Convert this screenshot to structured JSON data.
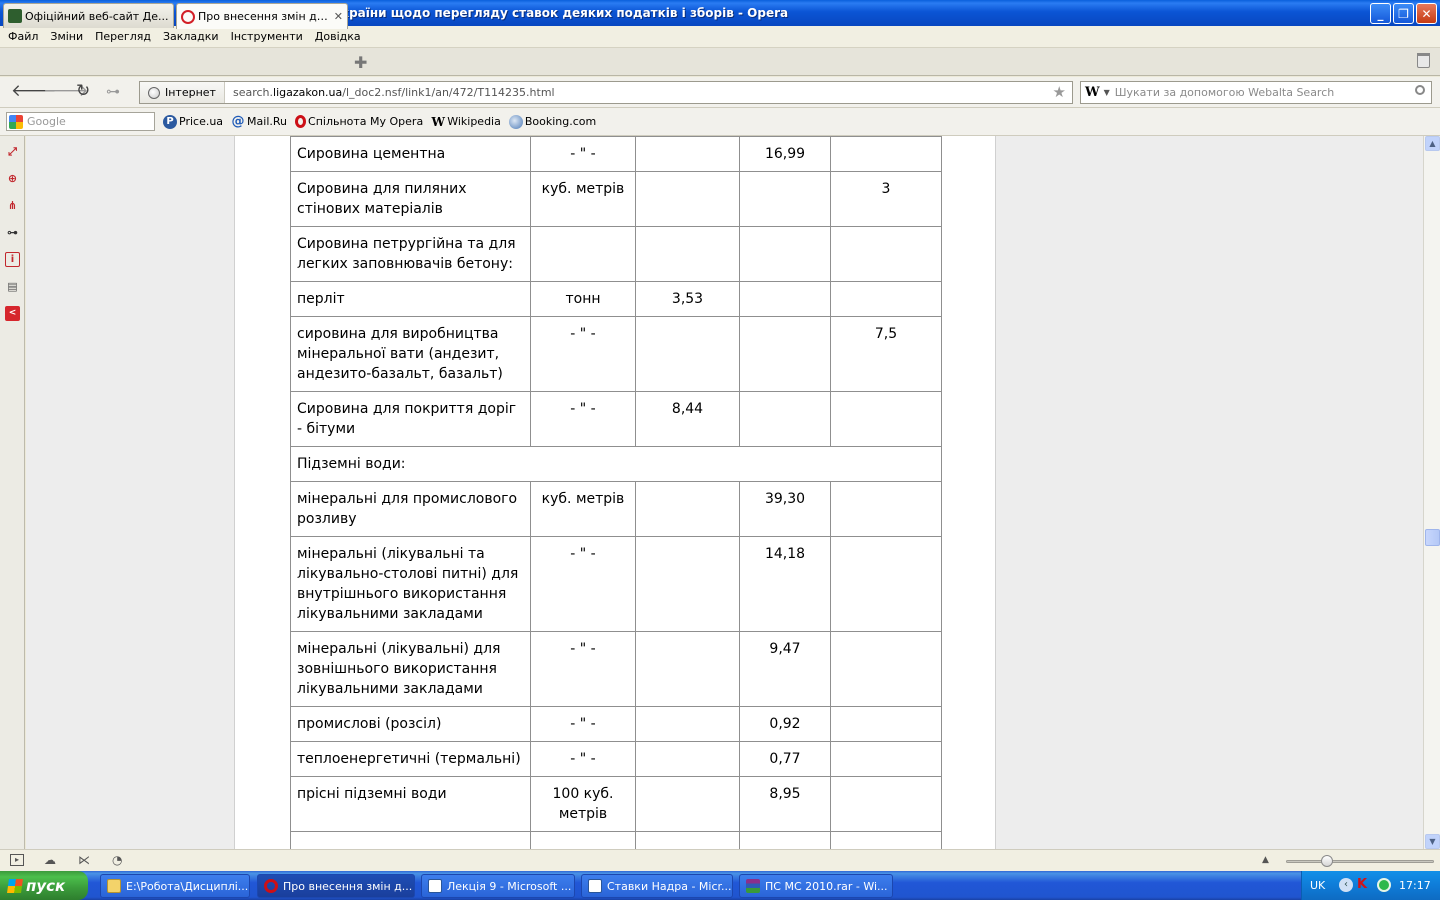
{
  "window": {
    "title": "Про внесення змін до Податкового кодексу України щодо перегляду ставок деяких податків і зборів - Opera",
    "minimize_label": "_",
    "maximize_label": "❐",
    "close_label": "✕"
  },
  "menu": [
    "Файл",
    "Зміни",
    "Перегляд",
    "Закладки",
    "Інструменти",
    "Довідка"
  ],
  "tabs": [
    {
      "label": "Офіційний веб-сайт Де...",
      "icon": "trident-icon"
    },
    {
      "label": "Про внесення змін до П...",
      "icon": "liga-icon",
      "close": "✕"
    }
  ],
  "address": {
    "site_label": "Інтернет",
    "url_prefix": "search.",
    "url_domain": "ligazakon.ua",
    "url_path": "/l_doc2.nsf/link1/an/472/T114235.html"
  },
  "search": {
    "engine": "W",
    "placeholder": "Шукати за допомогою Webalta Search"
  },
  "bookmarks": {
    "google_placeholder": "Google",
    "items": [
      {
        "label": "Price.ua",
        "icon": "price-icon"
      },
      {
        "label": "Mail.Ru",
        "icon": "mailru-icon"
      },
      {
        "label": "Спільнота My Opera",
        "icon": "opera-icon"
      },
      {
        "label": "Wikipedia",
        "icon": "wikipedia-icon"
      },
      {
        "label": "Booking.com",
        "icon": "booking-icon"
      }
    ]
  },
  "table": {
    "rows": [
      {
        "name": "",
        "unit": "",
        "c3": "",
        "c4": "",
        "c5": ""
      },
      {
        "name": "Сировина цементна",
        "unit": "- \" -",
        "c3": "",
        "c4": "16,99",
        "c5": ""
      },
      {
        "name": "Сировина для пиляних стінових матеріалів",
        "unit": "куб. метрів",
        "c3": "",
        "c4": "",
        "c5": "3"
      },
      {
        "name": "Сировина петрургійна та для легких заповнювачів бетону:",
        "unit": "",
        "c3": "",
        "c4": "",
        "c5": ""
      },
      {
        "name": "перліт",
        "unit": "тонн",
        "c3": "3,53",
        "c4": "",
        "c5": ""
      },
      {
        "name": "сировина для виробництва мінеральної вати (андезит, андезито-базальт, базальт)",
        "unit": "- \" -",
        "c3": "",
        "c4": "",
        "c5": "7,5"
      },
      {
        "name": "Сировина для покриття доріг - бітуми",
        "unit": "- \" -",
        "c3": "8,44",
        "c4": "",
        "c5": ""
      },
      {
        "section": "Підземні води:"
      },
      {
        "name": "мінеральні для промислового розливу",
        "unit": "куб. метрів",
        "c3": "",
        "c4": "39,30",
        "c5": ""
      },
      {
        "name": "мінеральні (лікувальні та лікувально-столові питні) для внутрішнього використання лікувальними закладами",
        "unit": "- \" -",
        "c3": "",
        "c4": "14,18",
        "c5": ""
      },
      {
        "name": "мінеральні (лікувальні) для зовнішнього використання лікувальними закладами",
        "unit": "- \" -",
        "c3": "",
        "c4": "9,47",
        "c5": ""
      },
      {
        "name": "промислові (розсіл)",
        "unit": "- \" -",
        "c3": "",
        "c4": "0,92",
        "c5": ""
      },
      {
        "name": "теплоенергетичні (термальні)",
        "unit": "- \" -",
        "c3": "",
        "c4": "0,77",
        "c5": ""
      },
      {
        "name": "прісні підземні води",
        "unit": "100 куб. метрів",
        "c3": "",
        "c4": "8,95",
        "c5": ""
      },
      {
        "name": "",
        "unit": "",
        "c3": "",
        "c4": "",
        "c5": ""
      }
    ]
  },
  "taskbar": {
    "start_label": "пуск",
    "tasks": [
      {
        "label": "E:\\Робота\\Дисциплі...",
        "icon": "folder-icon"
      },
      {
        "label": "Про внесення змін д...",
        "icon": "opera-icon"
      },
      {
        "label": "Лекція 9 - Microsoft ...",
        "icon": "word-icon"
      },
      {
        "label": "Ставки Надра - Micr...",
        "icon": "word-icon"
      },
      {
        "label": "ПС МС 2010.rar - Wi...",
        "icon": "winrar-icon"
      }
    ],
    "lang": "UK",
    "clock": "17:17"
  }
}
